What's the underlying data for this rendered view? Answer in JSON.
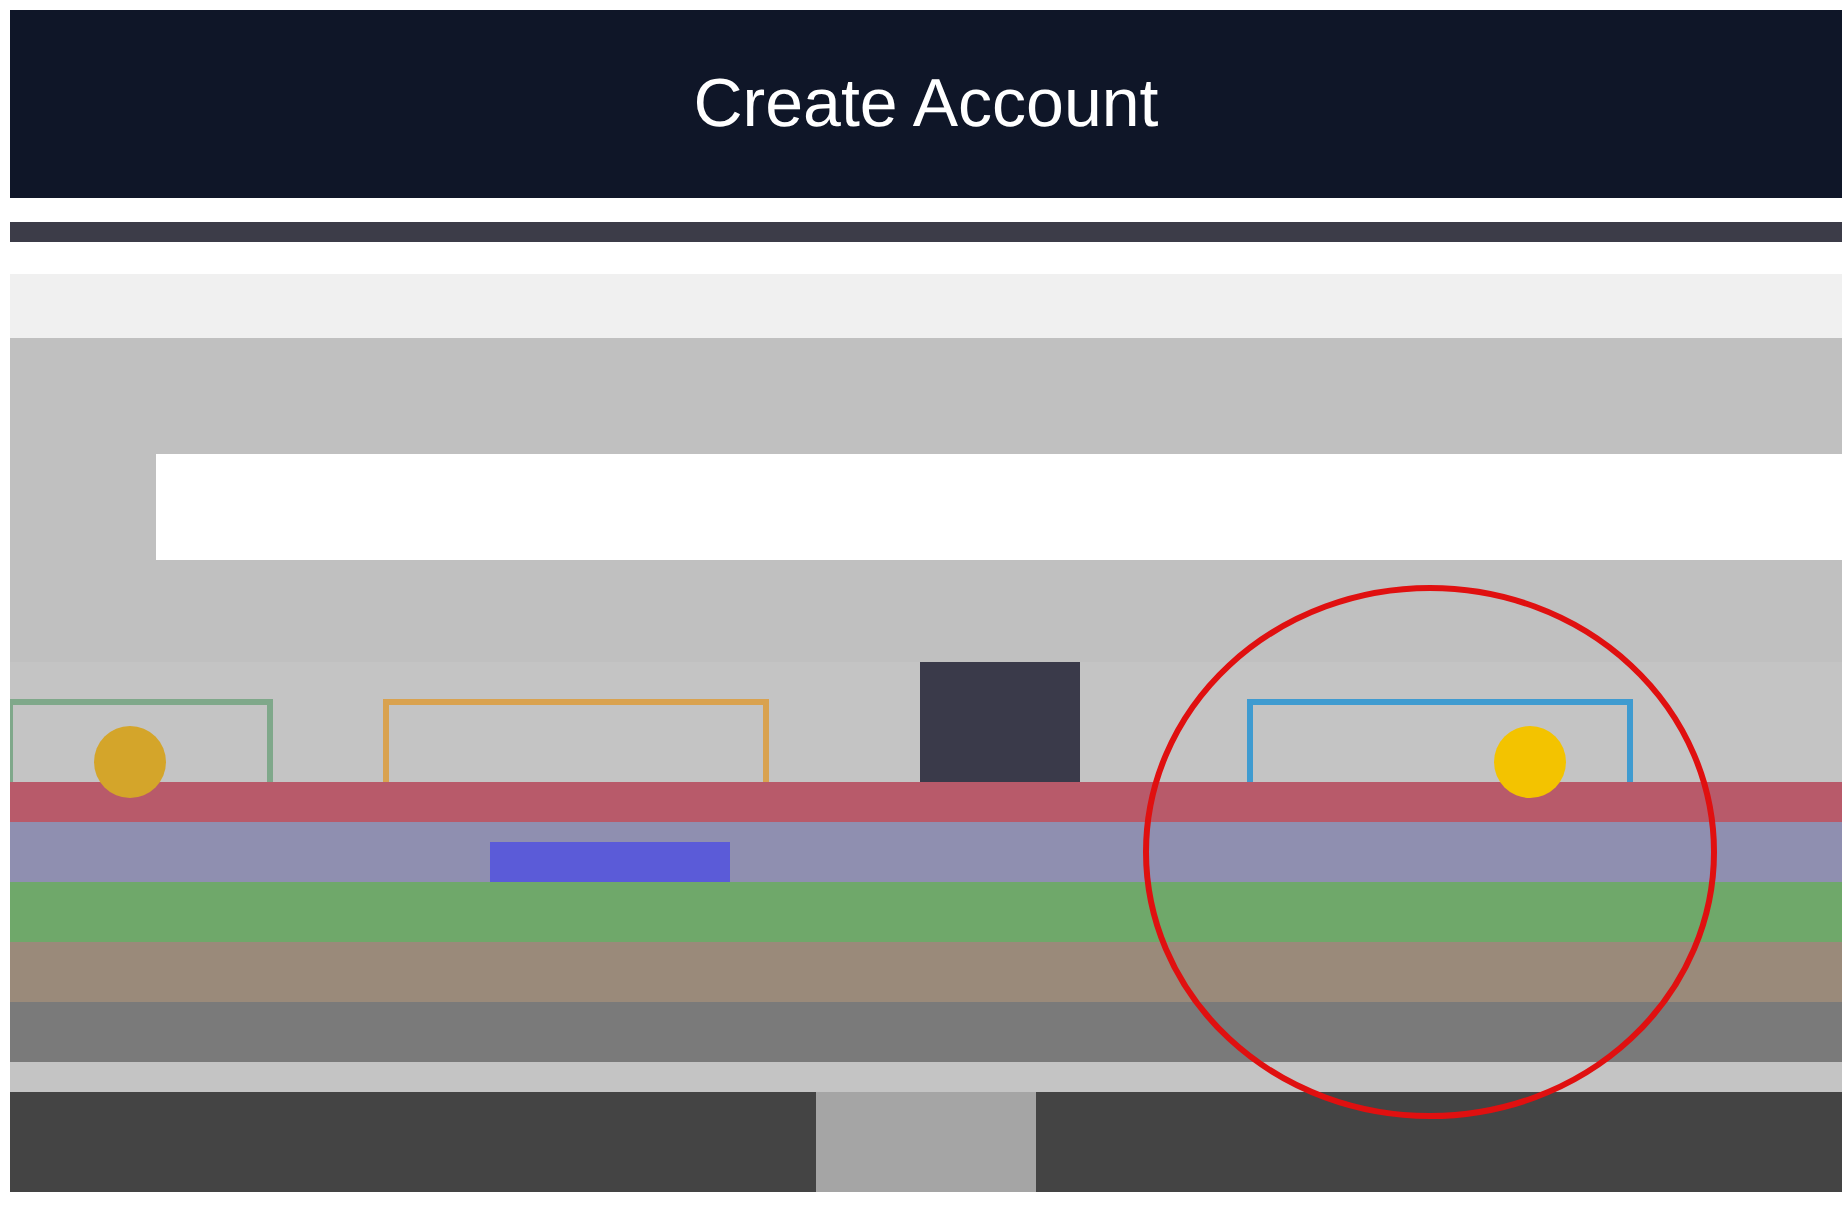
{
  "header": {
    "title": "Create Account"
  }
}
